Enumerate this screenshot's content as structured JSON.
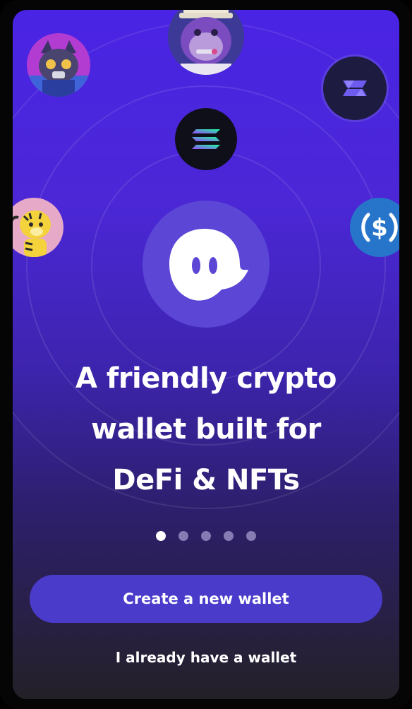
{
  "onboarding": {
    "headline_lines": [
      "A friendly crypto",
      "wallet built for",
      "DeFi & NFTs"
    ],
    "create_wallet_label": "Create a new wallet",
    "existing_wallet_label": "I already have a wallet",
    "carousel": {
      "pages": 5,
      "active_index": 0
    }
  },
  "icons": {
    "app_logo": "ghost-logo-icon",
    "solana": "solana-icon",
    "serum": "serum-icon",
    "usdc": "usdc-icon",
    "nft_ape": "ape-nft-avatar",
    "nft_cat": "cat-nft-avatar",
    "nft_tiger": "tiger-nft-avatar"
  },
  "colors": {
    "gradient_top": "#4a24e4",
    "gradient_bottom": "#232027",
    "button": "#4a3bcb",
    "logo_circle": "#5b46d6",
    "usdc": "#2775ca"
  }
}
